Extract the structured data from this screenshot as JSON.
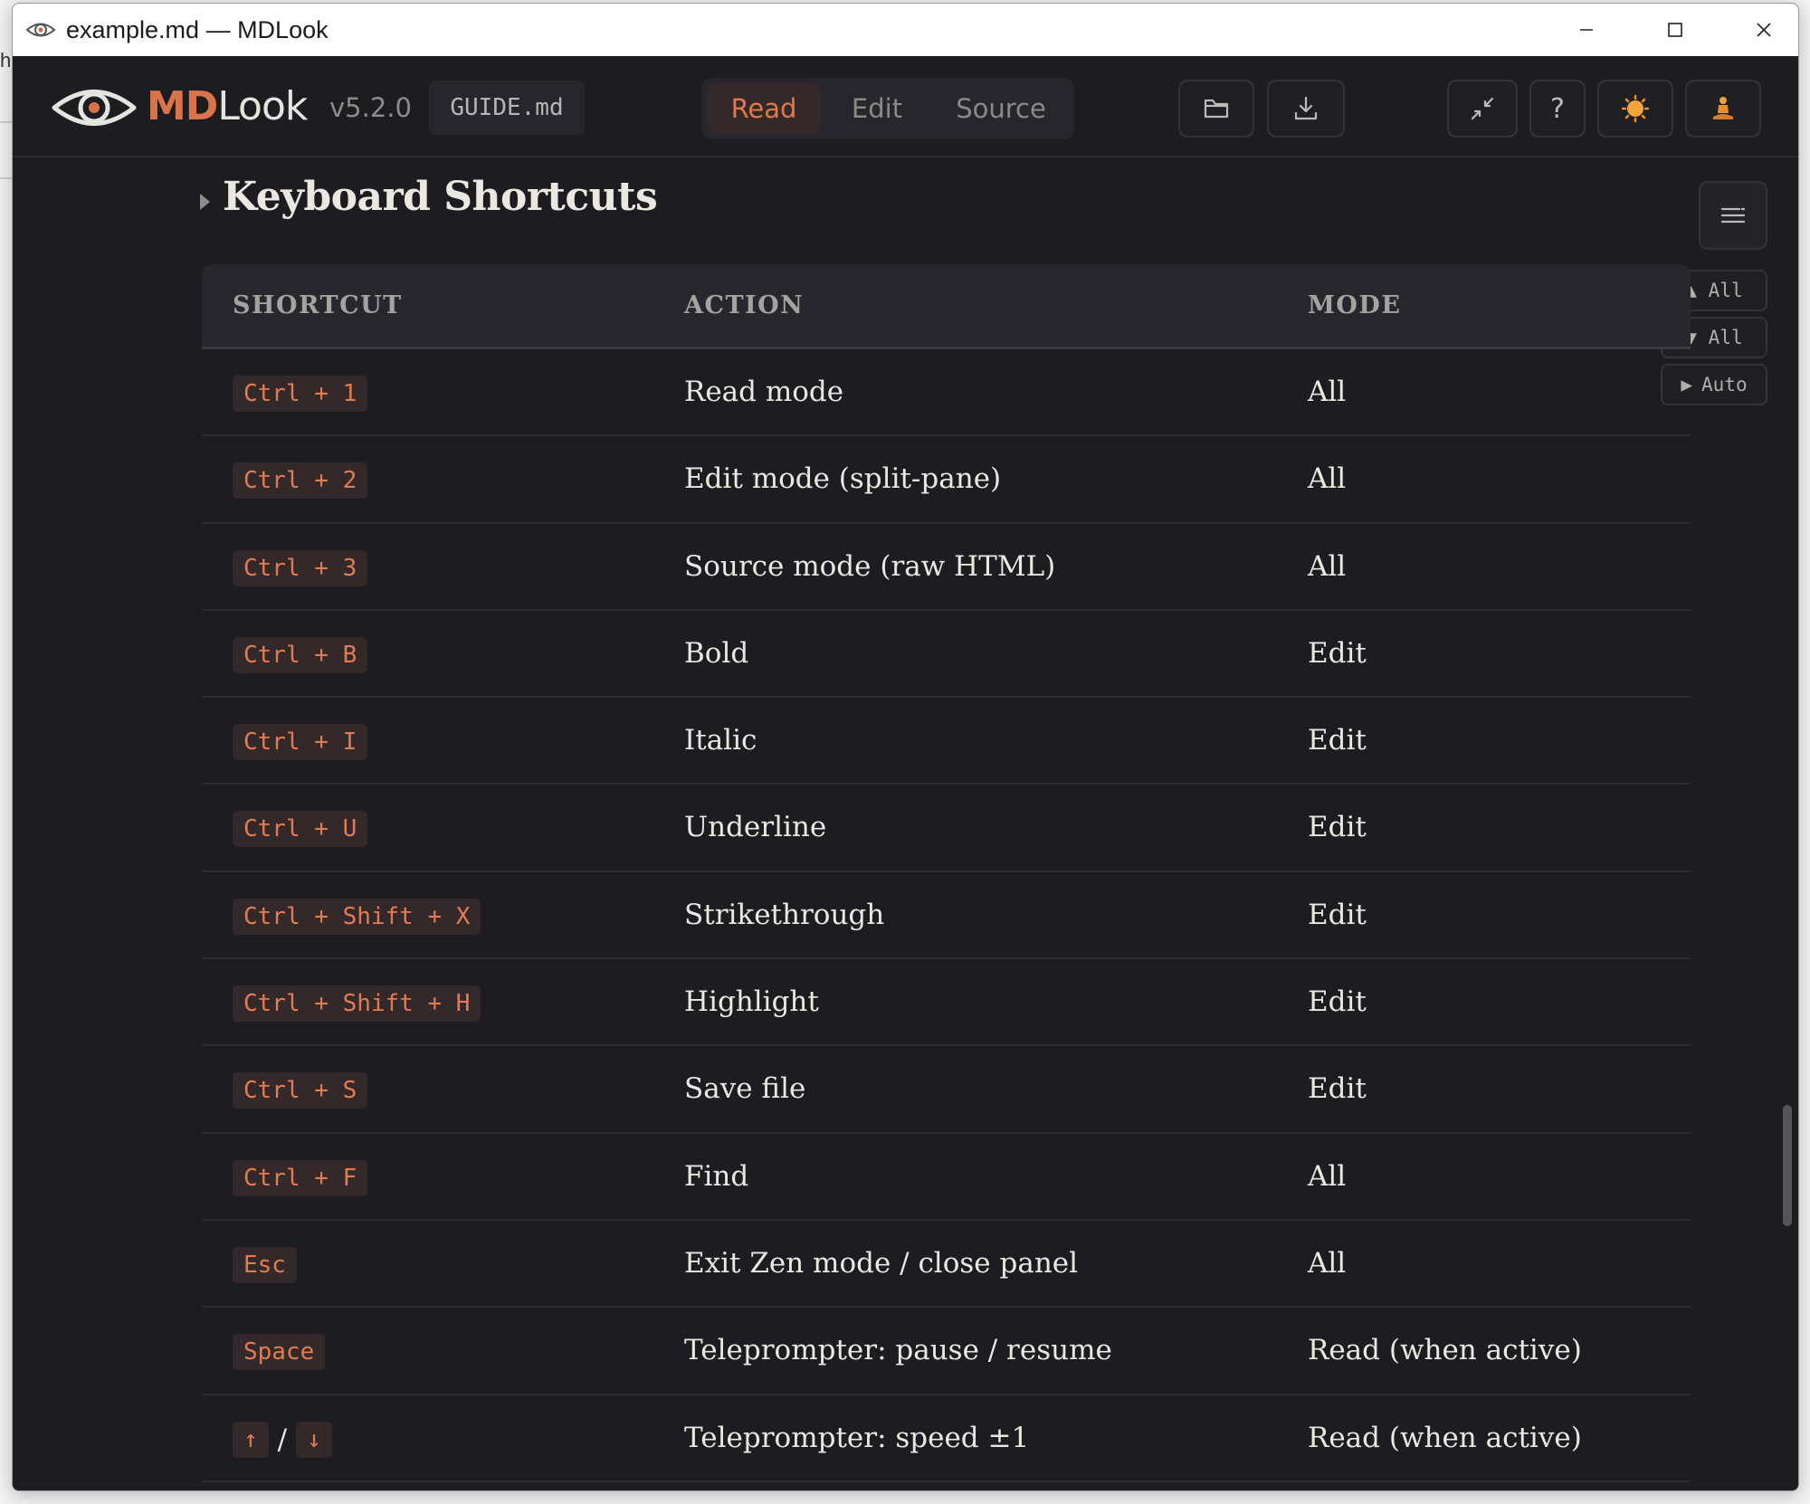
{
  "window": {
    "title": "example.md — MDLook"
  },
  "app": {
    "brand_accent": "MD",
    "brand_rest": "Look",
    "version": "v5.2.0",
    "file_name": "GUIDE.md",
    "modes": [
      "Read",
      "Edit",
      "Source"
    ],
    "active_mode": "Read",
    "accent_color": "#e0784d"
  },
  "content": {
    "section_title": "Keyboard Shortcuts",
    "side_controls": {
      "collapse_all": "▲ All",
      "expand_all": "▼ All",
      "auto": "Auto"
    },
    "table": {
      "headers": [
        "SHORTCUT",
        "ACTION",
        "MODE"
      ],
      "rows": [
        {
          "keys": [
            "Ctrl + 1"
          ],
          "action": "Read mode",
          "mode": "All"
        },
        {
          "keys": [
            "Ctrl + 2"
          ],
          "action": "Edit mode (split-pane)",
          "mode": "All"
        },
        {
          "keys": [
            "Ctrl + 3"
          ],
          "action": "Source mode (raw HTML)",
          "mode": "All"
        },
        {
          "keys": [
            "Ctrl + B"
          ],
          "action": "Bold",
          "mode": "Edit"
        },
        {
          "keys": [
            "Ctrl + I"
          ],
          "action": "Italic",
          "mode": "Edit"
        },
        {
          "keys": [
            "Ctrl + U"
          ],
          "action": "Underline",
          "mode": "Edit"
        },
        {
          "keys": [
            "Ctrl + Shift + X"
          ],
          "action": "Strikethrough",
          "mode": "Edit"
        },
        {
          "keys": [
            "Ctrl + Shift + H"
          ],
          "action": "Highlight",
          "mode": "Edit"
        },
        {
          "keys": [
            "Ctrl + S"
          ],
          "action": "Save file",
          "mode": "Edit"
        },
        {
          "keys": [
            "Ctrl + F"
          ],
          "action": "Find",
          "mode": "All"
        },
        {
          "keys": [
            "Esc"
          ],
          "action": "Exit Zen mode / close panel",
          "mode": "All"
        },
        {
          "keys": [
            "Space"
          ],
          "action": "Teleprompter: pause / resume",
          "mode": "Read (when active)"
        },
        {
          "keys": [
            "↑",
            "↓"
          ],
          "separator": "/",
          "action": "Teleprompter: speed ±1",
          "mode": "Read (when active)"
        }
      ]
    }
  },
  "icons": {
    "app": "eye-icon",
    "open": "folder-icon",
    "download": "download-icon",
    "zen": "collapse-arrows-icon",
    "help": "question-icon",
    "theme": "sun-icon",
    "focus": "meditation-icon",
    "toc": "list-icon"
  }
}
